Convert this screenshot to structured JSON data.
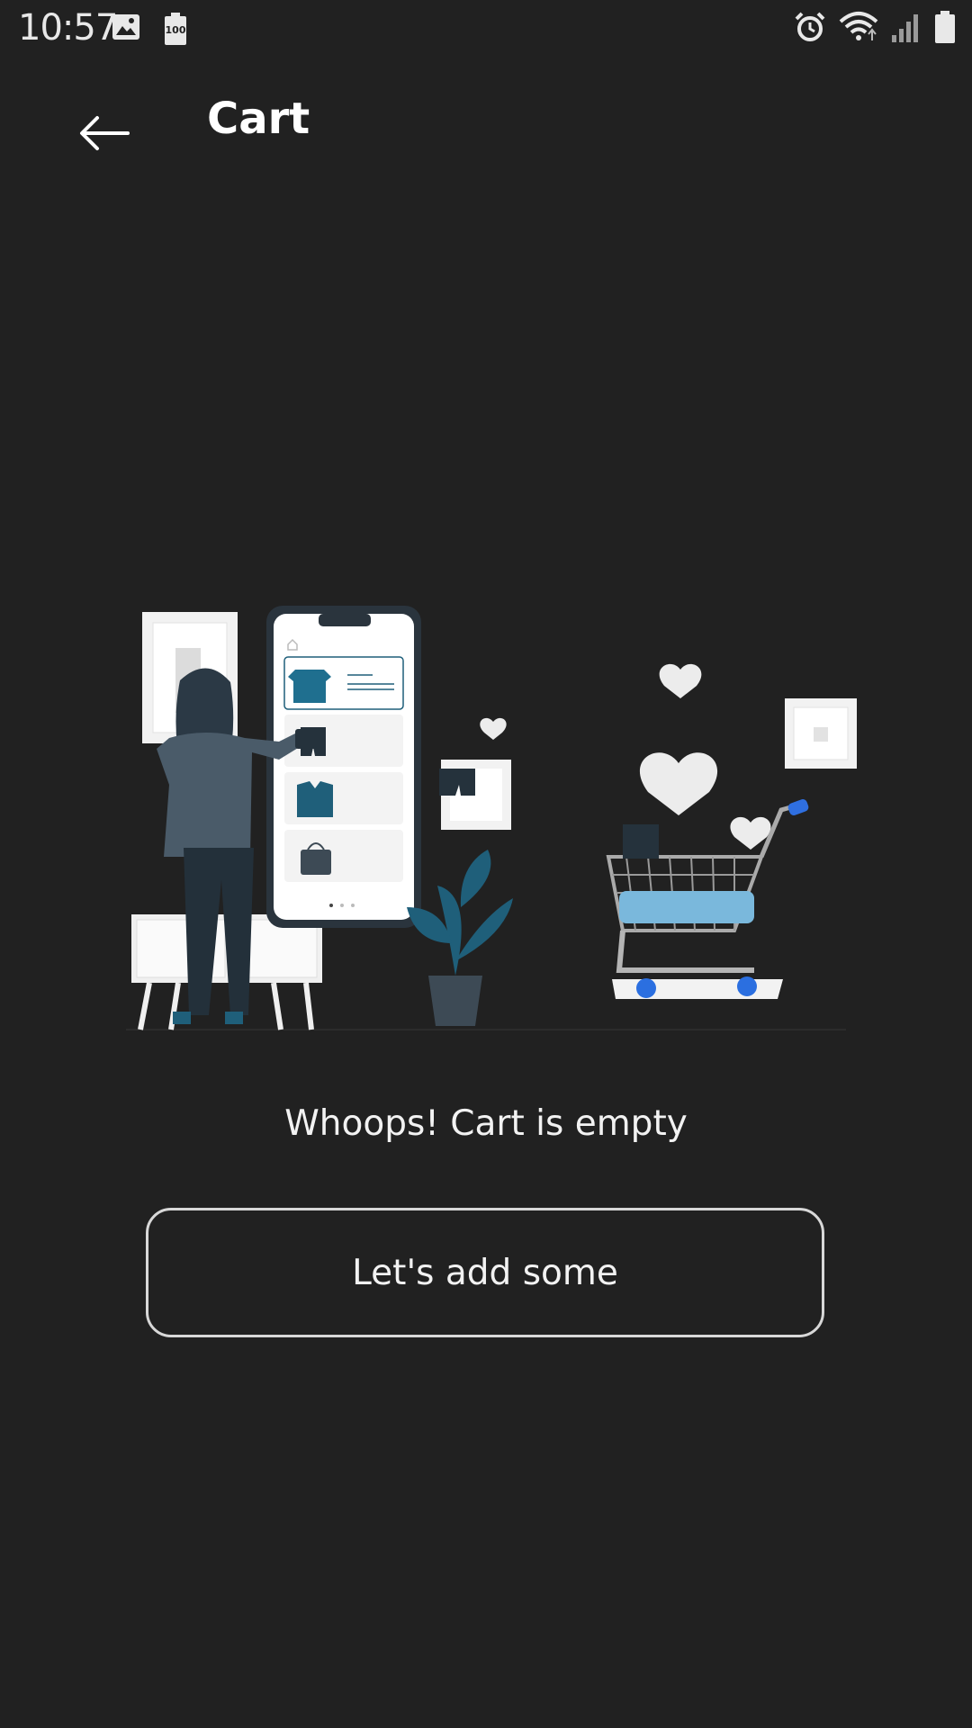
{
  "status_bar": {
    "time": "10:57",
    "battery_badge": "100",
    "icons": [
      "image-icon",
      "battery-saver-icon",
      "alarm-icon",
      "wifi-icon",
      "signal-icon",
      "battery-icon"
    ]
  },
  "app_bar": {
    "title": "Cart",
    "back_icon": "arrow-left-icon"
  },
  "empty_state": {
    "illustration": "empty-cart-illustration",
    "message": "Whoops! Cart is empty",
    "button_label": "Let's add some"
  },
  "colors": {
    "background": "#212121",
    "text": "#ffffff",
    "button_border": "#d8d8d8",
    "accent": "#1f5f7a"
  }
}
